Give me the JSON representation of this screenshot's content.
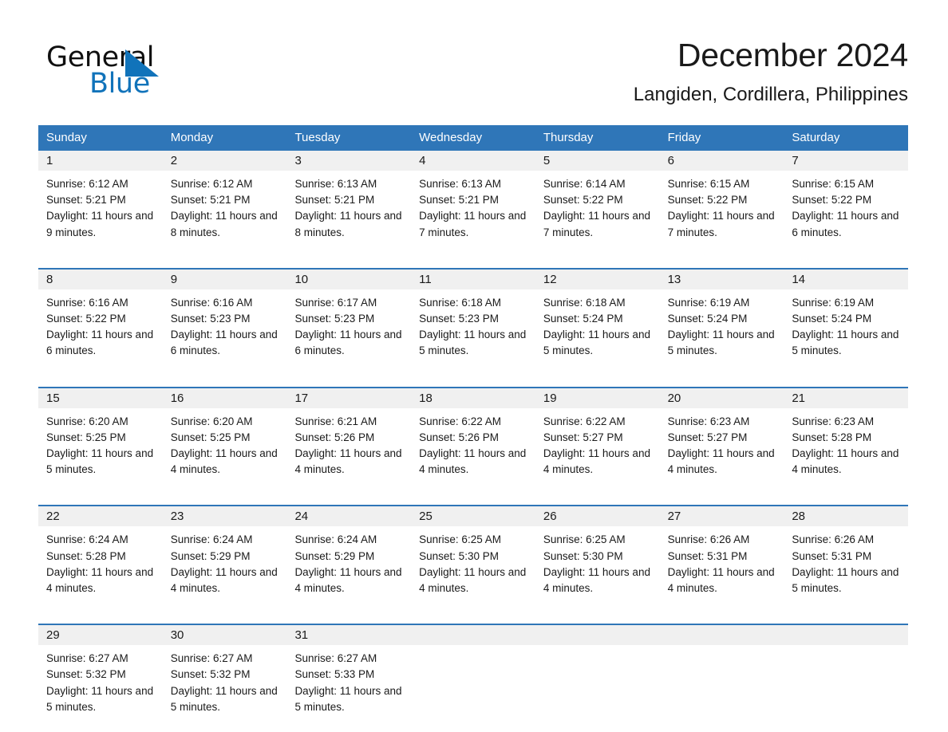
{
  "brand": {
    "name_part1": "General",
    "name_part2": "Blue",
    "triangle_color": "#1173ba"
  },
  "header": {
    "title": "December 2024",
    "subtitle": "Langiden, Cordillera, Philippines"
  },
  "theme": {
    "header_blue": "#2f76b8",
    "daynum_gray": "#f0f0f0",
    "text": "#1a1a1a"
  },
  "weekdays": [
    "Sunday",
    "Monday",
    "Tuesday",
    "Wednesday",
    "Thursday",
    "Friday",
    "Saturday"
  ],
  "weeks": [
    [
      {
        "day": "1",
        "sunrise": "Sunrise: 6:12 AM",
        "sunset": "Sunset: 5:21 PM",
        "daylight": "Daylight: 11 hours and 9 minutes."
      },
      {
        "day": "2",
        "sunrise": "Sunrise: 6:12 AM",
        "sunset": "Sunset: 5:21 PM",
        "daylight": "Daylight: 11 hours and 8 minutes."
      },
      {
        "day": "3",
        "sunrise": "Sunrise: 6:13 AM",
        "sunset": "Sunset: 5:21 PM",
        "daylight": "Daylight: 11 hours and 8 minutes."
      },
      {
        "day": "4",
        "sunrise": "Sunrise: 6:13 AM",
        "sunset": "Sunset: 5:21 PM",
        "daylight": "Daylight: 11 hours and 7 minutes."
      },
      {
        "day": "5",
        "sunrise": "Sunrise: 6:14 AM",
        "sunset": "Sunset: 5:22 PM",
        "daylight": "Daylight: 11 hours and 7 minutes."
      },
      {
        "day": "6",
        "sunrise": "Sunrise: 6:15 AM",
        "sunset": "Sunset: 5:22 PM",
        "daylight": "Daylight: 11 hours and 7 minutes."
      },
      {
        "day": "7",
        "sunrise": "Sunrise: 6:15 AM",
        "sunset": "Sunset: 5:22 PM",
        "daylight": "Daylight: 11 hours and 6 minutes."
      }
    ],
    [
      {
        "day": "8",
        "sunrise": "Sunrise: 6:16 AM",
        "sunset": "Sunset: 5:22 PM",
        "daylight": "Daylight: 11 hours and 6 minutes."
      },
      {
        "day": "9",
        "sunrise": "Sunrise: 6:16 AM",
        "sunset": "Sunset: 5:23 PM",
        "daylight": "Daylight: 11 hours and 6 minutes."
      },
      {
        "day": "10",
        "sunrise": "Sunrise: 6:17 AM",
        "sunset": "Sunset: 5:23 PM",
        "daylight": "Daylight: 11 hours and 6 minutes."
      },
      {
        "day": "11",
        "sunrise": "Sunrise: 6:18 AM",
        "sunset": "Sunset: 5:23 PM",
        "daylight": "Daylight: 11 hours and 5 minutes."
      },
      {
        "day": "12",
        "sunrise": "Sunrise: 6:18 AM",
        "sunset": "Sunset: 5:24 PM",
        "daylight": "Daylight: 11 hours and 5 minutes."
      },
      {
        "day": "13",
        "sunrise": "Sunrise: 6:19 AM",
        "sunset": "Sunset: 5:24 PM",
        "daylight": "Daylight: 11 hours and 5 minutes."
      },
      {
        "day": "14",
        "sunrise": "Sunrise: 6:19 AM",
        "sunset": "Sunset: 5:24 PM",
        "daylight": "Daylight: 11 hours and 5 minutes."
      }
    ],
    [
      {
        "day": "15",
        "sunrise": "Sunrise: 6:20 AM",
        "sunset": "Sunset: 5:25 PM",
        "daylight": "Daylight: 11 hours and 5 minutes."
      },
      {
        "day": "16",
        "sunrise": "Sunrise: 6:20 AM",
        "sunset": "Sunset: 5:25 PM",
        "daylight": "Daylight: 11 hours and 4 minutes."
      },
      {
        "day": "17",
        "sunrise": "Sunrise: 6:21 AM",
        "sunset": "Sunset: 5:26 PM",
        "daylight": "Daylight: 11 hours and 4 minutes."
      },
      {
        "day": "18",
        "sunrise": "Sunrise: 6:22 AM",
        "sunset": "Sunset: 5:26 PM",
        "daylight": "Daylight: 11 hours and 4 minutes."
      },
      {
        "day": "19",
        "sunrise": "Sunrise: 6:22 AM",
        "sunset": "Sunset: 5:27 PM",
        "daylight": "Daylight: 11 hours and 4 minutes."
      },
      {
        "day": "20",
        "sunrise": "Sunrise: 6:23 AM",
        "sunset": "Sunset: 5:27 PM",
        "daylight": "Daylight: 11 hours and 4 minutes."
      },
      {
        "day": "21",
        "sunrise": "Sunrise: 6:23 AM",
        "sunset": "Sunset: 5:28 PM",
        "daylight": "Daylight: 11 hours and 4 minutes."
      }
    ],
    [
      {
        "day": "22",
        "sunrise": "Sunrise: 6:24 AM",
        "sunset": "Sunset: 5:28 PM",
        "daylight": "Daylight: 11 hours and 4 minutes."
      },
      {
        "day": "23",
        "sunrise": "Sunrise: 6:24 AM",
        "sunset": "Sunset: 5:29 PM",
        "daylight": "Daylight: 11 hours and 4 minutes."
      },
      {
        "day": "24",
        "sunrise": "Sunrise: 6:24 AM",
        "sunset": "Sunset: 5:29 PM",
        "daylight": "Daylight: 11 hours and 4 minutes."
      },
      {
        "day": "25",
        "sunrise": "Sunrise: 6:25 AM",
        "sunset": "Sunset: 5:30 PM",
        "daylight": "Daylight: 11 hours and 4 minutes."
      },
      {
        "day": "26",
        "sunrise": "Sunrise: 6:25 AM",
        "sunset": "Sunset: 5:30 PM",
        "daylight": "Daylight: 11 hours and 4 minutes."
      },
      {
        "day": "27",
        "sunrise": "Sunrise: 6:26 AM",
        "sunset": "Sunset: 5:31 PM",
        "daylight": "Daylight: 11 hours and 4 minutes."
      },
      {
        "day": "28",
        "sunrise": "Sunrise: 6:26 AM",
        "sunset": "Sunset: 5:31 PM",
        "daylight": "Daylight: 11 hours and 5 minutes."
      }
    ],
    [
      {
        "day": "29",
        "sunrise": "Sunrise: 6:27 AM",
        "sunset": "Sunset: 5:32 PM",
        "daylight": "Daylight: 11 hours and 5 minutes."
      },
      {
        "day": "30",
        "sunrise": "Sunrise: 6:27 AM",
        "sunset": "Sunset: 5:32 PM",
        "daylight": "Daylight: 11 hours and 5 minutes."
      },
      {
        "day": "31",
        "sunrise": "Sunrise: 6:27 AM",
        "sunset": "Sunset: 5:33 PM",
        "daylight": "Daylight: 11 hours and 5 minutes."
      },
      {
        "day": "",
        "sunrise": "",
        "sunset": "",
        "daylight": ""
      },
      {
        "day": "",
        "sunrise": "",
        "sunset": "",
        "daylight": ""
      },
      {
        "day": "",
        "sunrise": "",
        "sunset": "",
        "daylight": ""
      },
      {
        "day": "",
        "sunrise": "",
        "sunset": "",
        "daylight": ""
      }
    ]
  ]
}
